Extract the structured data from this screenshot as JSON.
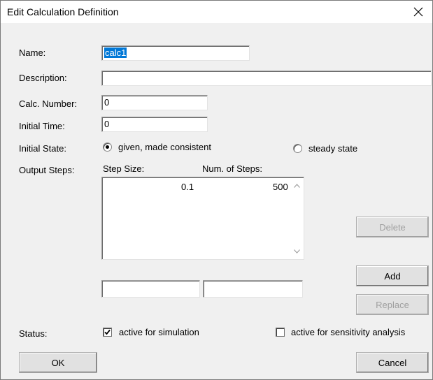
{
  "window": {
    "title": "Edit Calculation Definition"
  },
  "labels": {
    "name": "Name:",
    "description": "Description:",
    "calc_number": "Calc. Number:",
    "initial_time": "Initial Time:",
    "initial_state": "Initial State:",
    "output_steps": "Output Steps:",
    "status": "Status:",
    "step_size": "Step Size:",
    "num_steps": "Num. of Steps:"
  },
  "fields": {
    "name": "calc1",
    "description": "",
    "calc_number": "0",
    "initial_time": "0",
    "new_step_size": "",
    "new_num_steps": ""
  },
  "initial_state": {
    "options": [
      {
        "label": "given, made consistent",
        "selected": true
      },
      {
        "label": "steady state",
        "selected": false
      }
    ]
  },
  "output_steps_list": {
    "rows": [
      {
        "step_size": "0.1",
        "num_steps": "500"
      }
    ]
  },
  "buttons": {
    "delete": "Delete",
    "add": "Add",
    "replace": "Replace",
    "ok": "OK",
    "cancel": "Cancel"
  },
  "status": {
    "active_simulation": {
      "label": "active for simulation",
      "checked": true
    },
    "active_sensitivity": {
      "label": "active for sensitivity analysis",
      "checked": false
    }
  }
}
